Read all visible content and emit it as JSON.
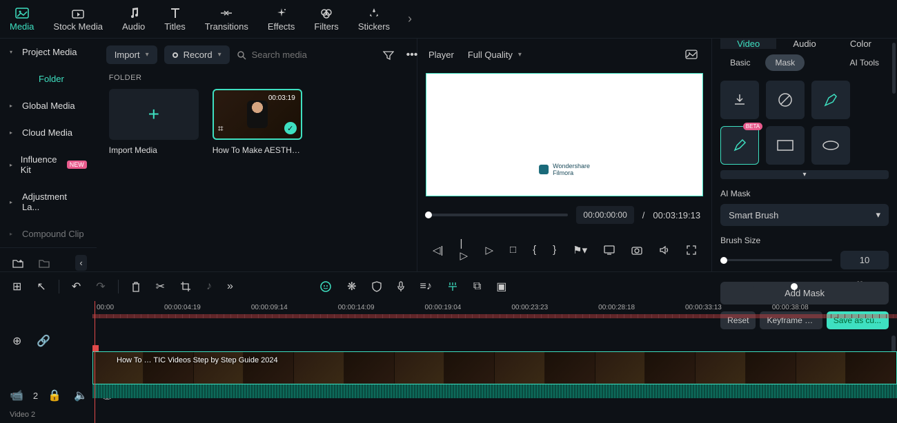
{
  "topnav": {
    "items": [
      {
        "label": "Media"
      },
      {
        "label": "Stock Media"
      },
      {
        "label": "Audio"
      },
      {
        "label": "Titles"
      },
      {
        "label": "Transitions"
      },
      {
        "label": "Effects"
      },
      {
        "label": "Filters"
      },
      {
        "label": "Stickers"
      }
    ]
  },
  "sidebar": {
    "project_media": "Project Media",
    "folder": "Folder",
    "items": [
      {
        "label": "Global Media"
      },
      {
        "label": "Cloud Media"
      },
      {
        "label": "Influence Kit",
        "badge": "NEW"
      },
      {
        "label": "Adjustment La..."
      },
      {
        "label": "Compound Clip"
      }
    ]
  },
  "media": {
    "import": "Import",
    "record": "Record",
    "search_placeholder": "Search media",
    "section": "FOLDER",
    "import_tile": "Import Media",
    "clip": {
      "name": "How To Make AESTHE...",
      "duration": "00:03:19"
    }
  },
  "player": {
    "label": "Player",
    "quality": "Full Quality",
    "watermark1": "Wondershare",
    "watermark2": "Filmora",
    "time_current": "00:00:00:00",
    "slash": "/",
    "time_total": "00:03:19:13"
  },
  "inspector": {
    "tabs": [
      "Video",
      "Audio",
      "Color"
    ],
    "subtabs": [
      "Basic",
      "Mask",
      "AI Tools"
    ],
    "beta": "BETA",
    "ai_mask_label": "AI Mask",
    "ai_mask_value": "Smart Brush",
    "brush_size_label": "Brush Size",
    "brush_size_value": "10",
    "add_mask": "Add Mask",
    "reset": "Reset",
    "keyframe": "Keyframe P...",
    "save": "Save as cu..."
  },
  "timeline": {
    "ticks": [
      "00:00",
      "00:00:04:19",
      "00:00:09:14",
      "00:00:14:09",
      "00:00:19:04",
      "00:00:23:23",
      "00:00:28:18",
      "00:00:33:13",
      "00:00:38:08"
    ],
    "clip_text": "How To …  TIC Videos    Step by Step Guide 2024",
    "track_count": "2",
    "track_label": "Video 2"
  }
}
